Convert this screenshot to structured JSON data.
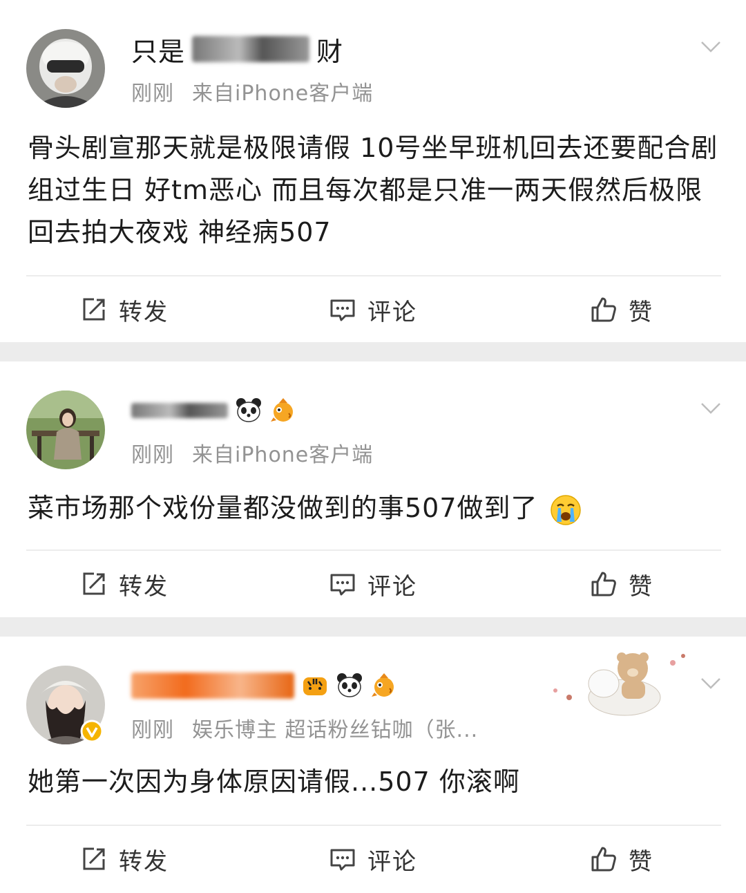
{
  "posts": [
    {
      "username": "只是",
      "username_tail": "财",
      "time": "刚刚",
      "source": "来自iPhone客户端",
      "text": "骨头剧宣那天就是极限请假 10号坐早班机回去还要配合剧组过生日 好tm恶心 而且每次都是只准一两天假然后极限回去拍大夜戏 神经病507",
      "actions": {
        "repost": "转发",
        "comment": "评论",
        "like": "赞"
      }
    },
    {
      "username": "",
      "username_tail": "",
      "time": "刚刚",
      "source": "来自iPhone客户端",
      "text": "菜市场那个戏份量都没做到的事507做到了",
      "actions": {
        "repost": "转发",
        "comment": "评论",
        "like": "赞"
      }
    },
    {
      "username": "",
      "username_tail": "",
      "time": "刚刚",
      "source": "娱乐博主 超话粉丝钻咖（张...",
      "text": "她第一次因为身体原因请假...507 你滚啊",
      "actions": {
        "repost": "转发",
        "comment": "评论",
        "like": "赞"
      }
    }
  ],
  "colors": {
    "page_bg": "#ececec",
    "card_bg": "#ffffff",
    "meta_gray": "#939393",
    "vip_orange": "#f26b1d",
    "verified_yellow": "#f5b400"
  },
  "icons": [
    "chevron-down-icon",
    "repost-icon",
    "comment-icon",
    "like-icon",
    "panda-icon",
    "fish-icon",
    "crying-emoji",
    "verified-icon",
    "tiger-icon"
  ]
}
